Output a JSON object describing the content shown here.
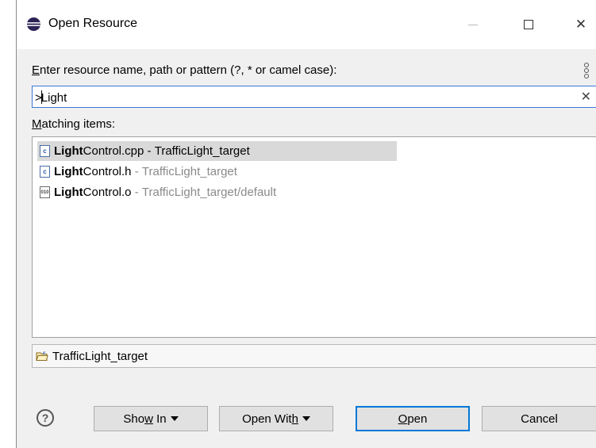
{
  "window": {
    "title": "Open Resource",
    "close_glyph": "✕"
  },
  "prompt": {
    "mnemonic": "E",
    "rest": "nter resource name, path or pattern (?, * or camel case):"
  },
  "search": {
    "value_before_caret": ">",
    "value_after_caret": "Light",
    "clear_glyph": "✕"
  },
  "matching": {
    "mnemonic": "M",
    "rest": "atching items:"
  },
  "results": [
    {
      "icon": "c",
      "match": "Light",
      "rest": "Control.cpp",
      "sep": " - ",
      "path": "TrafficLight_target",
      "selected": true
    },
    {
      "icon": "c",
      "match": "Light",
      "rest": "Control.h",
      "sep": " - ",
      "path": "TrafficLight_target",
      "selected": false
    },
    {
      "icon": "010",
      "match": "Light",
      "rest": "Control.o",
      "sep": " - ",
      "path": "TrafficLight_target/default",
      "selected": false
    }
  ],
  "project": {
    "name": "TrafficLight_target"
  },
  "buttons": {
    "help": "?",
    "show_in": {
      "pre": "Sho",
      "mnemonic": "w",
      "post": " In"
    },
    "open_with": {
      "pre": "Open Wit",
      "mnemonic": "h",
      "post": ""
    },
    "open": {
      "pre": "",
      "mnemonic": "O",
      "post": "pen"
    },
    "cancel": "Cancel"
  },
  "colors": {
    "accent": "#0078d7",
    "selection": "#d9d9d9",
    "path_grey": "#8a8a8a"
  }
}
